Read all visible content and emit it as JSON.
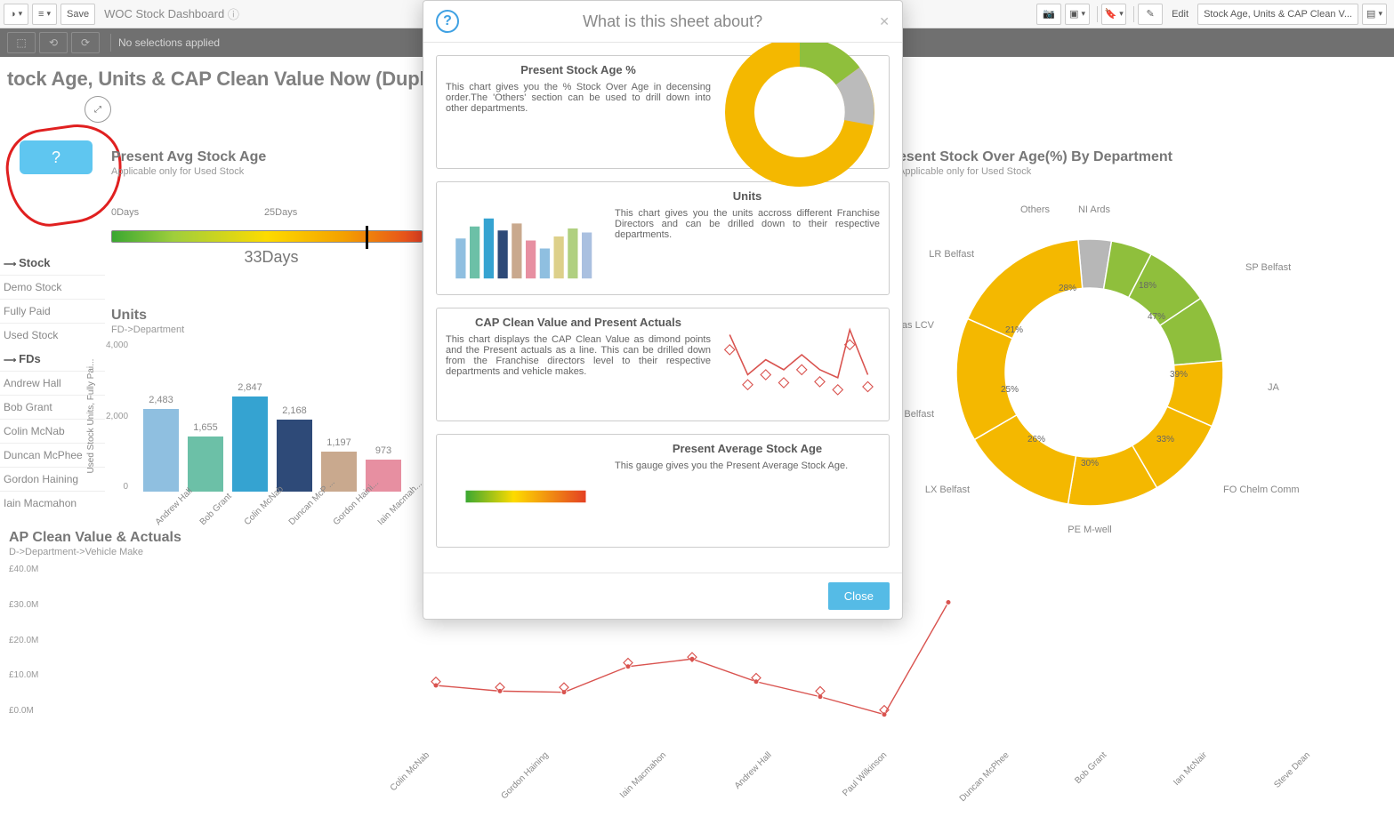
{
  "toolbar": {
    "save_label": "Save",
    "app_title": "WOC Stock Dashboard",
    "edit_label": "Edit",
    "sheet_dropdown": "Stock Age, Units & CAP Clean V..."
  },
  "selection_bar": {
    "text": "No selections applied"
  },
  "page_title": "tock Age, Units & CAP Clean Value Now (Duplicated)",
  "help_button": "?",
  "gauge": {
    "title": "Present Avg Stock Age",
    "subtitle": "Applicable only for Used Stock",
    "min": "0Days",
    "mid": "25Days",
    "max": "",
    "value": "33Days"
  },
  "filters": {
    "stock_header": "Stock",
    "stock_items": [
      "Demo Stock",
      "Fully Paid",
      "Used Stock"
    ],
    "fds_header": "FDs",
    "fd_items": [
      "Andrew Hall",
      "Bob Grant",
      "Colin McNab",
      "Duncan McPhee",
      "Gordon Haining",
      "Iain Macmahon"
    ]
  },
  "units": {
    "title": "Units",
    "subtitle": "FD->Department",
    "ylabel": "Used Stock Units, Fully Pai...",
    "yticks": [
      "4,000",
      "2,000",
      "0"
    ]
  },
  "cap": {
    "title": "AP Clean Value & Actuals",
    "subtitle": "D->Department->Vehicle Make",
    "yticks": [
      "£40.0M",
      "£30.0M",
      "£20.0M",
      "£10.0M",
      "£0.0M"
    ]
  },
  "donut": {
    "title": "esent Stock Over Age(%) By Department",
    "subtitle": "Applicable only for Used Stock"
  },
  "modal": {
    "title": "What is this sheet about?",
    "close_label": "Close",
    "cards": [
      {
        "title": "Present Stock Age %",
        "text": "This chart gives you the % Stock Over Age in decensing order.The 'Others' section can be used to drill down into other departments."
      },
      {
        "title": "Units",
        "text": "This chart gives you the units accross different Franchise Directors and can be drilled down to their respective departments."
      },
      {
        "title": "CAP Clean Value and Present Actuals",
        "text": "This chart displays the CAP Clean Value as dimond points and the Present actuals as a line. This can be drilled down from the Franchise directors level to their respective departments and vehicle makes."
      },
      {
        "title": "Present Average Stock Age",
        "text": "This gauge gives you the Present Average Stock Age."
      }
    ]
  },
  "chart_data": {
    "units_bar": {
      "type": "bar",
      "categories": [
        "Andrew Hall",
        "Bob Grant",
        "Colin McNab",
        "Duncan McP ...",
        "Gordon Haini...",
        "Iain Macmah..."
      ],
      "values": [
        2483,
        1655,
        2847,
        2168,
        1197,
        973
      ],
      "colors": [
        "#8fbfe0",
        "#6cc0a7",
        "#35a3d1",
        "#2e4a78",
        "#c9a98e",
        "#e78fa1"
      ],
      "ylim": [
        0,
        4000
      ]
    },
    "cap_line": {
      "type": "line",
      "categories": [
        "Colin McNab",
        "Gordon Haining",
        "Iain Macmahon",
        "Andrew Hall",
        "Paul Wilkinson",
        "Duncan McPhee",
        "Bob Grant",
        "Ian McNair",
        "Steve Dean"
      ],
      "line_values_M": [
        8,
        6.5,
        6.2,
        13,
        15,
        9,
        5,
        0.3,
        30
      ],
      "diamond_values_M": [
        9,
        7.5,
        7.5,
        14,
        15.5,
        10,
        6.5,
        1.5,
        null
      ],
      "ylim": [
        0,
        40
      ],
      "y_unit": "£M"
    },
    "donut": {
      "type": "pie",
      "inner_labels": [
        "18%",
        "28%",
        "21%",
        "25%",
        "26%",
        "30%",
        "33%",
        "39%",
        "47%"
      ],
      "outer_labels": [
        "NI Ards",
        "Others",
        "SP Belfast",
        "LR Belfast",
        "VW Glas LCV",
        "PE Belfast",
        "LX Belfast",
        "PE M-well",
        "FO Chelm Comm",
        "JA"
      ],
      "arc_pct": [
        4,
        5,
        8,
        8,
        8,
        10,
        11,
        14,
        15,
        17
      ],
      "colors": [
        "#b7b7b7",
        "#8fbf3c",
        "#8fbf3c",
        "#8fbf3c",
        "#f4b800",
        "#f4b800",
        "#f4b800",
        "#f4b800",
        "#f4b800",
        "#f4b800"
      ]
    }
  }
}
